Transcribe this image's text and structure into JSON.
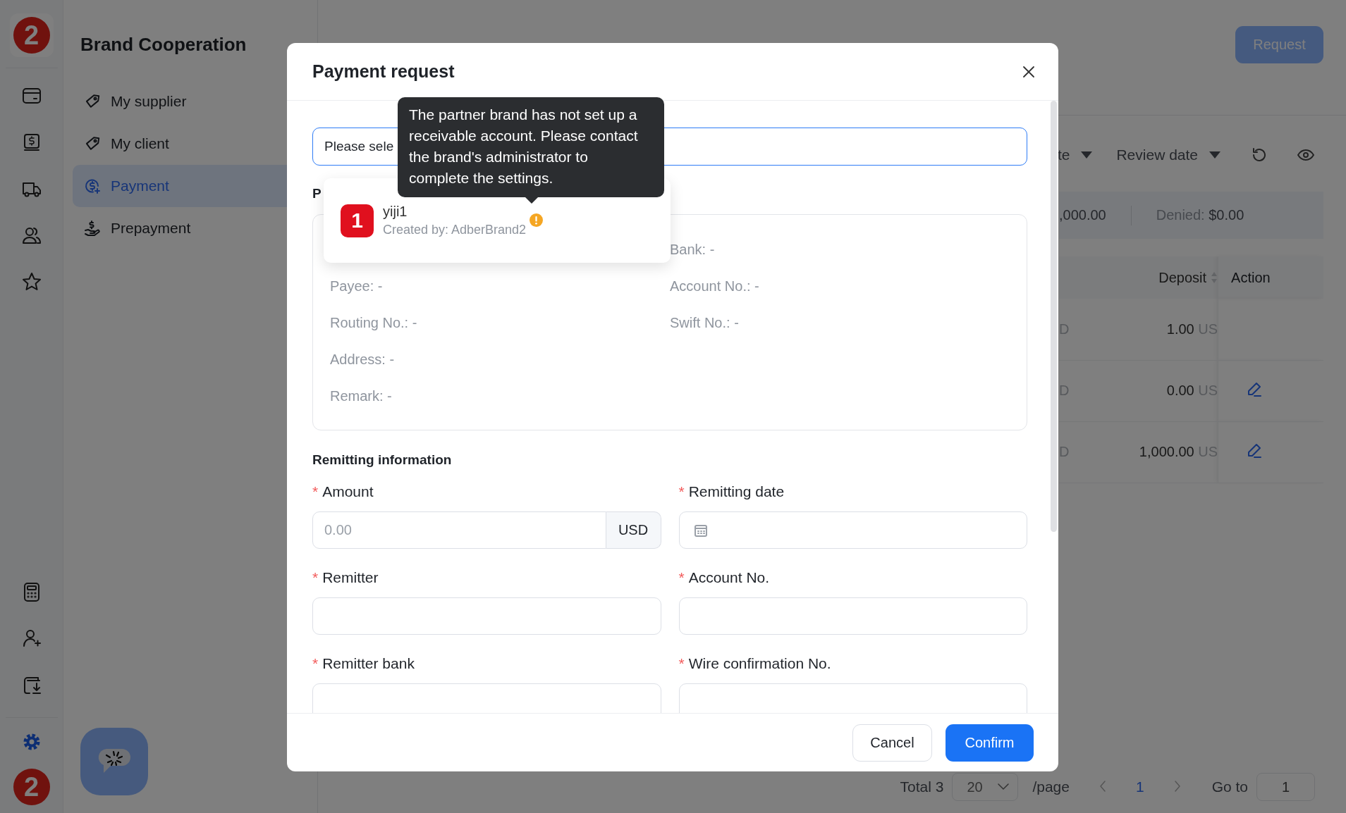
{
  "rail": {
    "logo": "2",
    "items": [
      {
        "selected": false
      },
      {
        "selected": false
      },
      {
        "selected": false
      },
      {
        "selected": false
      },
      {
        "selected": false
      }
    ],
    "bottom_items": [
      {
        "selected": false
      },
      {
        "selected": false
      },
      {
        "selected": false
      }
    ],
    "settings": {
      "selected": true
    },
    "avatar": "2"
  },
  "sidebar": {
    "title": "Brand Cooperation",
    "items": [
      {
        "label": "My supplier",
        "selected": false
      },
      {
        "label": "My client",
        "selected": false
      },
      {
        "label": "Payment",
        "selected": true
      },
      {
        "label": "Prepayment",
        "selected": false
      }
    ]
  },
  "page": {
    "request_button": "Request",
    "filters": [
      {
        "label": "te",
        "kind": "dropdown"
      },
      {
        "label": "Review date",
        "kind": "dropdown"
      },
      {
        "kind": "refresh"
      },
      {
        "kind": "view"
      }
    ],
    "summary": [
      {
        "value": ",000.00"
      },
      {
        "label": "Denied:",
        "value": "$0.00"
      }
    ],
    "table": {
      "columns": [
        "Deposit",
        "Action"
      ],
      "rows": [
        {
          "column_1": "D",
          "deposit": "1.00",
          "unit": "US",
          "editable": false
        },
        {
          "column_1": "D",
          "deposit": "0.00",
          "unit": "US",
          "editable": true
        },
        {
          "column_1": "D",
          "deposit": "1,000.00",
          "unit": "US",
          "editable": true
        }
      ]
    },
    "pagination": {
      "total": "Total 3",
      "page_size": "20",
      "per_page": "/page",
      "pages": [
        {
          "label": "1",
          "selected": true
        }
      ],
      "goto_label": "Go to",
      "goto_value": "1"
    }
  },
  "modal": {
    "title": "Payment request",
    "select": {
      "placeholder": "Please sele"
    },
    "section_title": "P",
    "payee_info": {
      "left": [
        "Payee: -",
        "Routing No.: -",
        "Address: -",
        "Remark: -"
      ],
      "right": [
        "Bank: -",
        "Account No.: -",
        "Swift No.: -"
      ]
    },
    "remitting_title": "Remitting information",
    "fields": [
      {
        "label": "Amount",
        "marker": "*",
        "kind": "amount",
        "placeholder": "0.00",
        "addon": "USD"
      },
      {
        "label": "Remitting date",
        "marker": "*",
        "kind": "date"
      },
      {
        "label": "Remitter",
        "marker": "*",
        "kind": "text"
      },
      {
        "label": "Account No.",
        "marker": "*",
        "kind": "text"
      },
      {
        "label": "Remitter bank",
        "marker": "*",
        "kind": "text"
      },
      {
        "label": "Wire confirmation No.",
        "marker": "*",
        "kind": "text"
      }
    ],
    "buttons": [
      {
        "label": "Cancel",
        "kind": "secondary"
      },
      {
        "label": "Confirm",
        "kind": "primary"
      }
    ],
    "dropdown": {
      "options": [
        {
          "badge": "1",
          "name": "yiji1",
          "created_by": "Created by: AdberBrand2",
          "warning": true
        }
      ]
    },
    "tooltip": {
      "text": "The partner brand has not set up a receivable account. Please contact the brand's administrator to complete the settings."
    }
  }
}
